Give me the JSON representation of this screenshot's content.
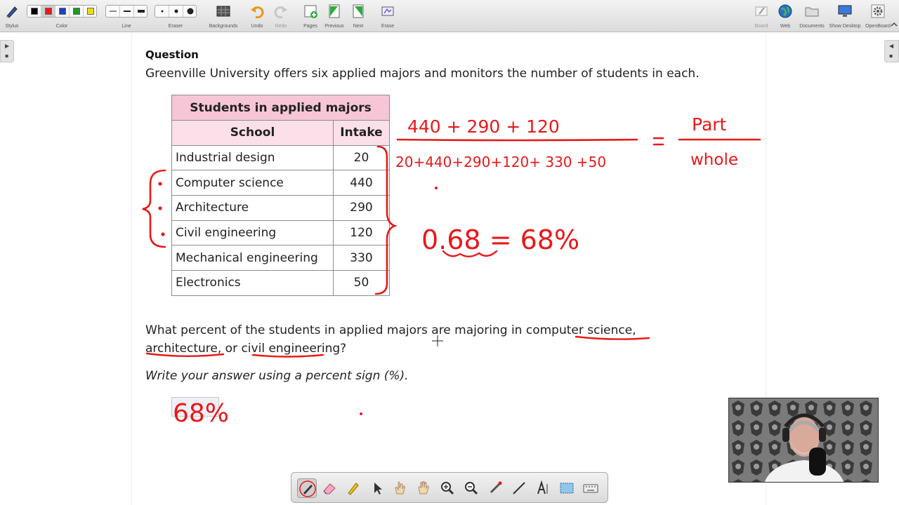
{
  "toolbar": {
    "left_groups": [
      {
        "label": "Stylus",
        "icon": "stylus-icon"
      },
      {
        "label": "Color",
        "icon": "color-palette-icon"
      },
      {
        "label": "Line",
        "icon": "line-width-icon"
      },
      {
        "label": "Eraser",
        "icon": "eraser-size-icon"
      },
      {
        "label": "Backgrounds",
        "icon": "backgrounds-icon"
      },
      {
        "label": "Undo",
        "icon": "undo-icon"
      },
      {
        "label": "Redo",
        "icon": "redo-icon"
      },
      {
        "label": "Pages",
        "icon": "pages-icon"
      },
      {
        "label": "Previous",
        "icon": "previous-icon"
      },
      {
        "label": "Next",
        "icon": "next-icon"
      },
      {
        "label": "Erase",
        "icon": "erase-icon"
      }
    ],
    "right_groups": [
      {
        "label": "Board",
        "icon": "board-icon"
      },
      {
        "label": "Web",
        "icon": "web-globe-icon"
      },
      {
        "label": "Documents",
        "icon": "documents-folder-icon"
      },
      {
        "label": "Show Desktop",
        "icon": "show-desktop-icon"
      },
      {
        "label": "OpenBoard",
        "icon": "openboard-gear-icon"
      }
    ],
    "colors": [
      "#000000",
      "#e8191a",
      "#2040c0",
      "#1a9a2a",
      "#f0e000"
    ],
    "selected_color": "#e8191a"
  },
  "question": {
    "label": "Question",
    "text": "Greenville University offers six applied majors and monitors the number of students in each.",
    "table_caption": "Students in applied majors",
    "columns": [
      "School",
      "Intake"
    ],
    "rows": [
      {
        "school": "Industrial design",
        "intake": "20"
      },
      {
        "school": "Computer science",
        "intake": "440"
      },
      {
        "school": "Architecture",
        "intake": "290"
      },
      {
        "school": "Civil engineering",
        "intake": "120"
      },
      {
        "school": "Mechanical engineering",
        "intake": "330"
      },
      {
        "school": "Electronics",
        "intake": "50"
      }
    ],
    "prompt_line1": "What percent of the students in applied majors are majoring in computer science,",
    "prompt_line2": "architecture, or civil engineering?",
    "instruction": "Write your answer using a percent sign (%).",
    "answer": "68%"
  },
  "annotations": {
    "numerator": "440 + 290 + 120",
    "denominator": "20+440+290+120+ 330 +50",
    "equals": "=",
    "part": "Part",
    "whole": "whole",
    "result": "0.68 = 68%"
  },
  "bottom_tools": [
    "pen-icon",
    "eraser-icon",
    "marker-icon",
    "selector-icon",
    "interact-hand-icon",
    "hand-pan-icon",
    "zoom-in-icon",
    "zoom-out-icon",
    "laser-pointer-icon",
    "line-tool-icon",
    "text-tool-icon",
    "capture-icon",
    "keyboard-icon"
  ]
}
